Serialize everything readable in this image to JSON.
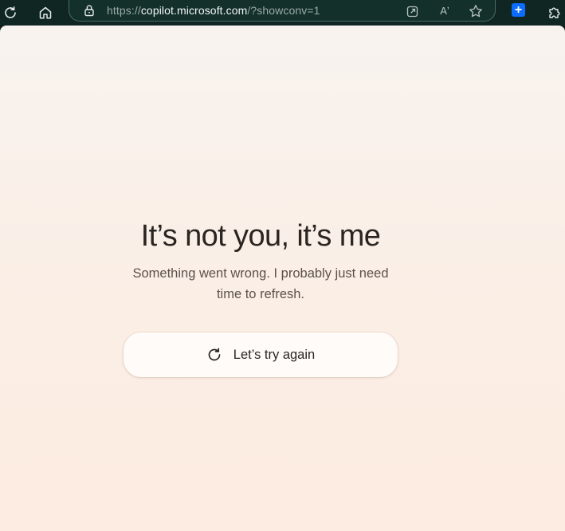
{
  "browser": {
    "url_scheme": "https://",
    "url_host": "copilot.microsoft.com",
    "url_path": "/?showconv=1",
    "read_aloud_label": "Aʼ",
    "extension_label": "+",
    "icons": {
      "refresh": "refresh-icon",
      "home": "home-icon",
      "lock": "lock-icon",
      "open_in_app": "open-in-app-icon",
      "read_aloud": "read-aloud-icon",
      "favorite": "star-icon",
      "extension": "extension-icon",
      "extensions": "puzzle-icon"
    }
  },
  "error_page": {
    "title": "It’s not you, it’s me",
    "message": "Something went wrong. I probably just need time to refresh.",
    "retry_label": "Let’s try again"
  },
  "colors": {
    "toolbar_bg": "#0f2622",
    "page_bg_top": "#f8f3ef",
    "page_bg_bottom": "#fcece1",
    "text_primary": "#2a2521",
    "text_secondary": "#5a524c",
    "extension_blue": "#0b6cff"
  }
}
